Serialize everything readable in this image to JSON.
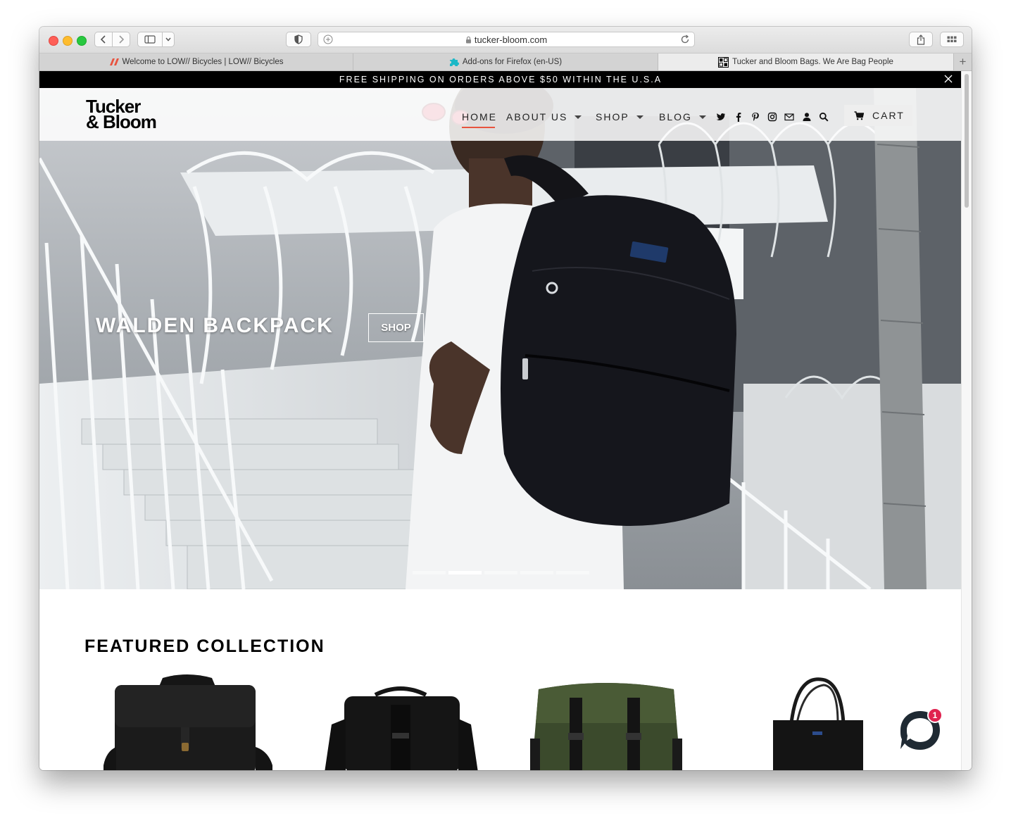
{
  "browser": {
    "url": "tucker-bloom.com",
    "tabs": [
      {
        "label": "Welcome to LOW// Bicycles | LOW// Bicycles",
        "active": false
      },
      {
        "label": "Add-ons for Firefox (en-US)",
        "active": false
      },
      {
        "label": "Tucker and Bloom Bags. We Are Bag People",
        "active": true
      }
    ],
    "new_tab_label": "+"
  },
  "announcement": {
    "text": "FREE SHIPPING ON ORDERS ABOVE $50 WITHIN THE U.S.A"
  },
  "logo": {
    "line1": "Tucker",
    "line2": "& Bloom"
  },
  "nav": {
    "home": "HOME",
    "about": "ABOUT US",
    "shop": "SHOP",
    "blog": "BLOG",
    "cart": "CART"
  },
  "hero": {
    "title": "WALDEN BACKPACK",
    "button": "SHOP",
    "slide_count": 5,
    "active_slide": 2
  },
  "featured": {
    "title": "FEATURED COLLECTION"
  },
  "chat": {
    "badge": "1"
  },
  "colors": {
    "accent": "#e8533f",
    "chat_dark": "#1f2a33",
    "badge": "#e0224f"
  }
}
